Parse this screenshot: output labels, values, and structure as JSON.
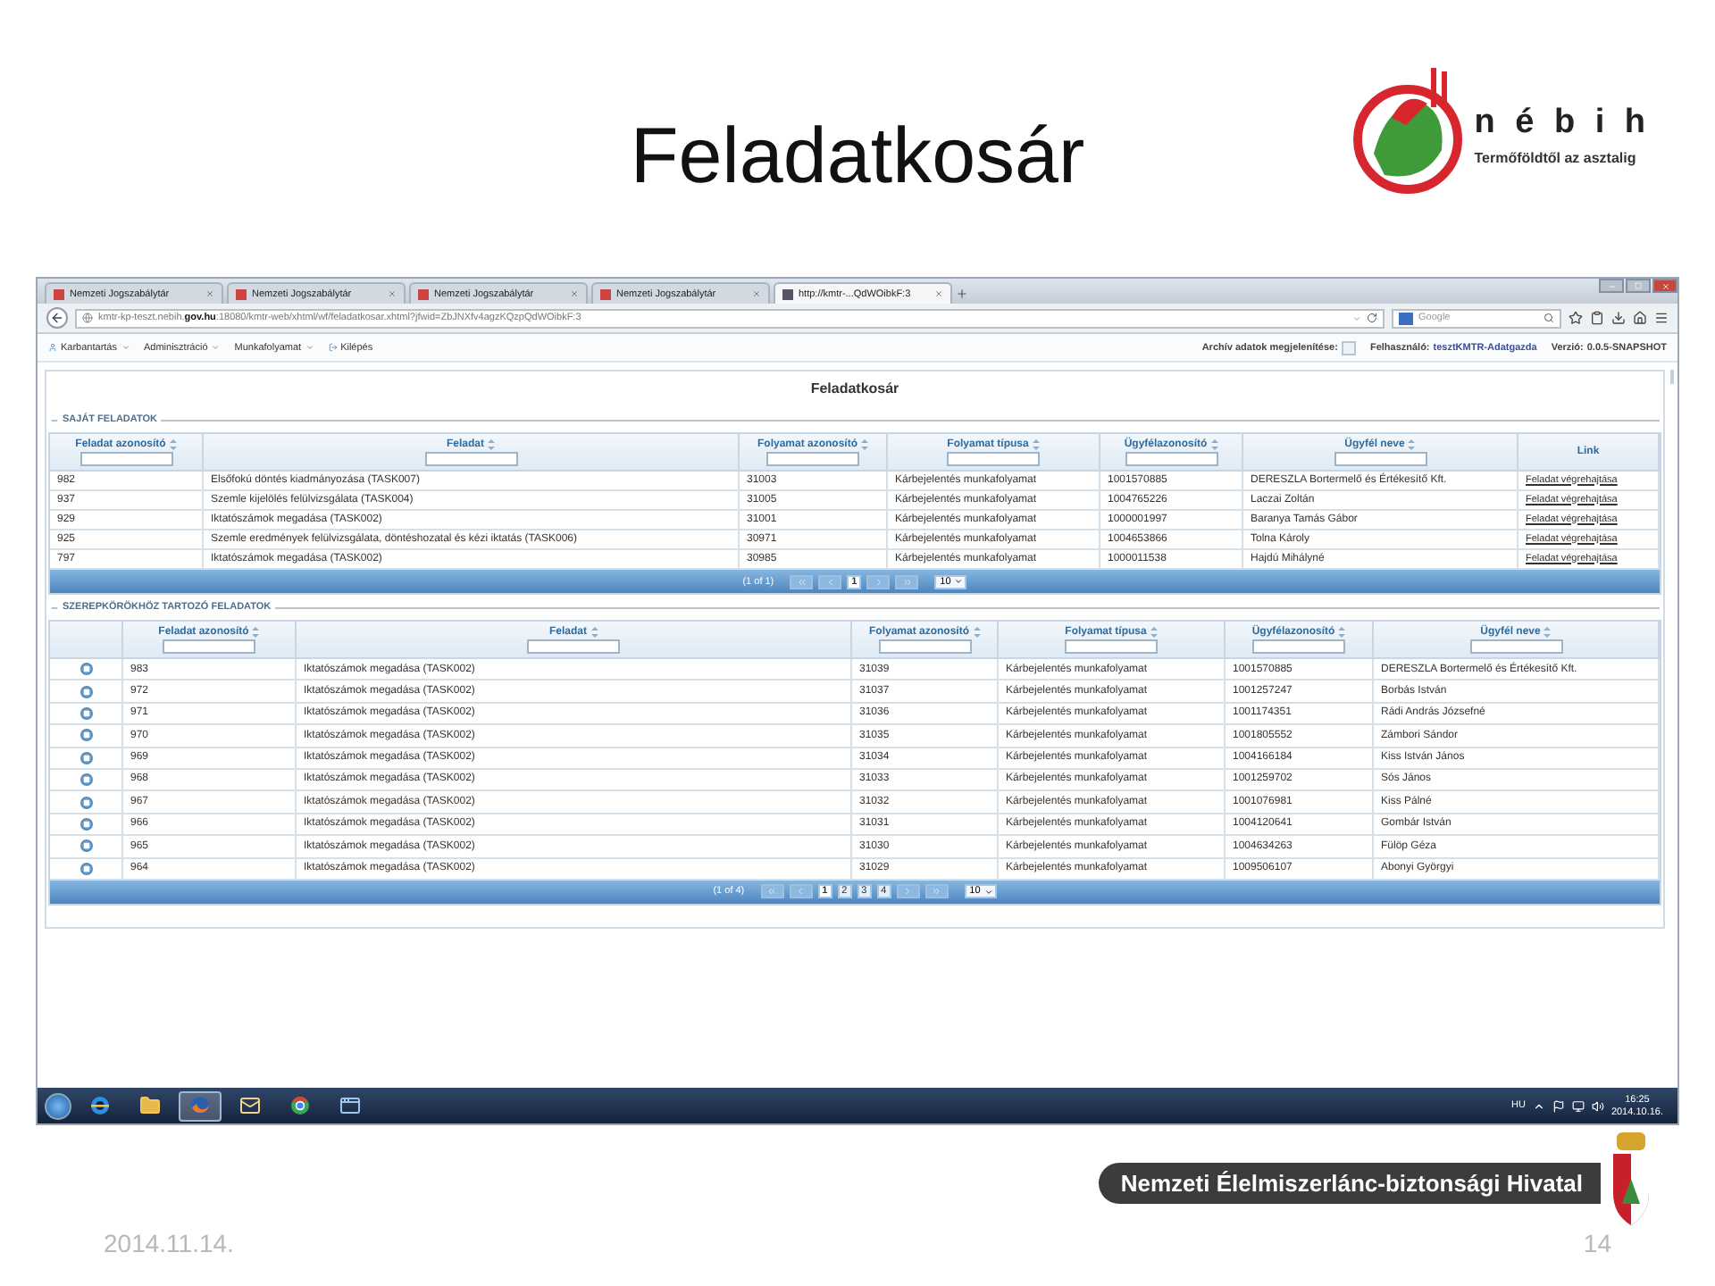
{
  "slide": {
    "title": "Feladatkosár",
    "logo": {
      "brand": "n é b i h",
      "tagline": "Termőföldtől az asztalig"
    },
    "footer": {
      "organization": "Nemzeti Élelmiszerlánc-biztonsági Hivatal",
      "date": "2014.11.14.",
      "page": "14"
    }
  },
  "browser": {
    "tabs": [
      {
        "label": "Nemzeti Jogszabálytár",
        "selected": false
      },
      {
        "label": "Nemzeti Jogszabálytár",
        "selected": false
      },
      {
        "label": "Nemzeti Jogszabálytár",
        "selected": false
      },
      {
        "label": "Nemzeti Jogszabálytár",
        "selected": false
      },
      {
        "label": "http://kmtr-...QdWOibkF:3",
        "selected": true
      }
    ],
    "address": "kmtr-kp-teszt.nebih.**gov.hu**:18080/kmtr-web/xhtml/wf/feladatkosar.xhtml?jfwid=ZbJNXfv4agzKQzpQdWOibkF:3",
    "search": {
      "placeholder": "Google"
    }
  },
  "app": {
    "menu": [
      {
        "label": "Karbantartás",
        "kind": "dropdown"
      },
      {
        "label": "Adminisztráció",
        "kind": "dropdown"
      },
      {
        "label": "Munkafolyamat",
        "kind": "dropdown"
      },
      {
        "label": "Kilépés",
        "kind": "action"
      }
    ],
    "archive": {
      "label": "Archív adatok megjelenítése:",
      "checked": false
    },
    "user": {
      "label": "Felhasználó:",
      "value": "tesztKMTR-Adatgazda"
    },
    "version": {
      "label": "Verzió:",
      "value": "0.0.5-SNAPSHOT"
    },
    "page_title": "Feladatkosár",
    "sections": [
      {
        "title": "SAJÁT FELADATOK",
        "has_row_icon": false,
        "columns": [
          {
            "label": "Feladat azonosító",
            "sortable": true,
            "filter": true
          },
          {
            "label": "Feladat",
            "sortable": true,
            "filter": true
          },
          {
            "label": "Folyamat azonosító",
            "sortable": true,
            "filter": true
          },
          {
            "label": "Folyamat típusa",
            "sortable": true,
            "filter": true
          },
          {
            "label": "Ügyfélazonosító",
            "sortable": true,
            "filter": true
          },
          {
            "label": "Ügyfél neve",
            "sortable": true,
            "filter": true
          },
          {
            "label": "Link",
            "sortable": false,
            "filter": false
          }
        ],
        "rows": [
          [
            "982",
            "Elsőfokú döntés kiadmányozása (TASK007)",
            "31003",
            "Kárbejelentés munkafolyamat",
            "1001570885",
            "DERESZLA Bortermelő és Értékesítő Kft.",
            "Feladat végrehajtása"
          ],
          [
            "937",
            "Szemle kijelölés felülvizsgálata (TASK004)",
            "31005",
            "Kárbejelentés munkafolyamat",
            "1004765226",
            "Laczai Zoltán",
            "Feladat végrehajtása"
          ],
          [
            "929",
            "Iktatószámok megadása (TASK002)",
            "31001",
            "Kárbejelentés munkafolyamat",
            "1000001997",
            "Baranya Tamás Gábor",
            "Feladat végrehajtása"
          ],
          [
            "925",
            "Szemle eredmények felülvizsgálata, döntéshozatal és kézi iktatás (TASK006)",
            "30971",
            "Kárbejelentés munkafolyamat",
            "1004653866",
            "Tolna Károly",
            "Feladat végrehajtása"
          ],
          [
            "797",
            "Iktatószámok megadása (TASK002)",
            "30985",
            "Kárbejelentés munkafolyamat",
            "1000011538",
            "Hajdú Mihályné",
            "Feladat végrehajtása"
          ]
        ],
        "pager": {
          "summary": "(1 of 1)",
          "pages": [
            {
              "label": "1",
              "selected": true
            }
          ],
          "page_size": "10"
        }
      },
      {
        "title": "SZEREPKÖRÖKHÖZ TARTOZÓ FELADATOK",
        "has_row_icon": true,
        "columns": [
          {
            "label": "Feladat azonosító",
            "sortable": true,
            "filter": true
          },
          {
            "label": "Feladat",
            "sortable": true,
            "filter": true
          },
          {
            "label": "Folyamat azonosító",
            "sortable": true,
            "filter": true
          },
          {
            "label": "Folyamat típusa",
            "sortable": true,
            "filter": true
          },
          {
            "label": "Ügyfélazonosító",
            "sortable": true,
            "filter": true
          },
          {
            "label": "Ügyfél neve",
            "sortable": true,
            "filter": true
          }
        ],
        "rows": [
          [
            "983",
            "Iktatószámok megadása (TASK002)",
            "31039",
            "Kárbejelentés munkafolyamat",
            "1001570885",
            "DERESZLA Bortermelő és Értékesítő Kft."
          ],
          [
            "972",
            "Iktatószámok megadása (TASK002)",
            "31037",
            "Kárbejelentés munkafolyamat",
            "1001257247",
            "Borbás István"
          ],
          [
            "971",
            "Iktatószámok megadása (TASK002)",
            "31036",
            "Kárbejelentés munkafolyamat",
            "1001174351",
            "Rádi András Józsefné"
          ],
          [
            "970",
            "Iktatószámok megadása (TASK002)",
            "31035",
            "Kárbejelentés munkafolyamat",
            "1001805552",
            "Zámbori Sándor"
          ],
          [
            "969",
            "Iktatószámok megadása (TASK002)",
            "31034",
            "Kárbejelentés munkafolyamat",
            "1004166184",
            "Kiss István János"
          ],
          [
            "968",
            "Iktatószámok megadása (TASK002)",
            "31033",
            "Kárbejelentés munkafolyamat",
            "1001259702",
            "Sós János"
          ],
          [
            "967",
            "Iktatószámok megadása (TASK002)",
            "31032",
            "Kárbejelentés munkafolyamat",
            "1001076981",
            "Kiss Pálné"
          ],
          [
            "966",
            "Iktatószámok megadása (TASK002)",
            "31031",
            "Kárbejelentés munkafolyamat",
            "1004120641",
            "Gombár István"
          ],
          [
            "965",
            "Iktatószámok megadása (TASK002)",
            "31030",
            "Kárbejelentés munkafolyamat",
            "1004634263",
            "Fülöp Géza"
          ],
          [
            "964",
            "Iktatószámok megadása (TASK002)",
            "31029",
            "Kárbejelentés munkafolyamat",
            "1009506107",
            "Abonyi Györgyi"
          ]
        ],
        "pager": {
          "summary": "(1 of 4)",
          "pages": [
            {
              "label": "1",
              "selected": true
            },
            {
              "label": "2",
              "selected": false
            },
            {
              "label": "3",
              "selected": false
            },
            {
              "label": "4",
              "selected": false
            }
          ],
          "page_size": "10"
        }
      }
    ]
  },
  "taskbar": {
    "apps": [
      {
        "kind": "ie",
        "selected": false
      },
      {
        "kind": "folder",
        "selected": false
      },
      {
        "kind": "firefox",
        "selected": true
      },
      {
        "kind": "mail",
        "selected": false
      },
      {
        "kind": "chrome",
        "selected": false
      },
      {
        "kind": "app",
        "selected": false
      }
    ],
    "language": "HU",
    "time": "16:25",
    "date": "2014.10.16."
  }
}
